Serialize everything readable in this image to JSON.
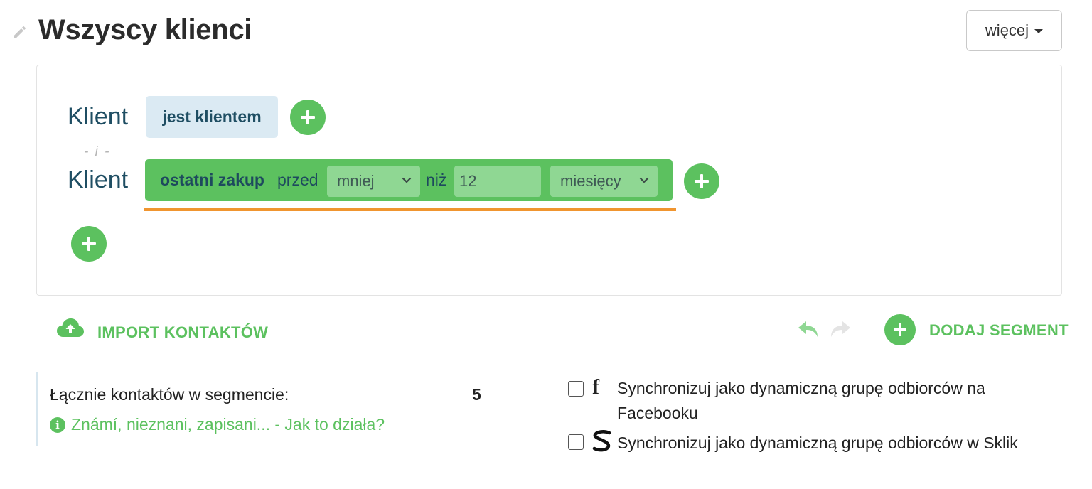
{
  "header": {
    "title": "Wszyscy klienci",
    "more_label": "więcej"
  },
  "segment": {
    "row1": {
      "label": "Klient",
      "chip": "jest klientem"
    },
    "separator": "- i -",
    "row2": {
      "label": "Klient",
      "condition_name": "ostatni zakup",
      "text_before": "przed",
      "comparison_select": "mniej",
      "text_between": "niż",
      "value_input": "12",
      "unit_select": "miesięcy"
    }
  },
  "actions": {
    "import_label": "IMPORT KONTAKTÓW",
    "add_segment_label": "DODAJ SEGMENT"
  },
  "stats": {
    "total_label": "Łącznie kontaktów w segmencie:",
    "total_value": "5",
    "help_link": "Známí, nieznani, zapisani... - Jak to działa?"
  },
  "sync": {
    "facebook_label": "Synchronizuj jako dynamiczną grupę odbiorców na Facebooku",
    "sklik_label": "Synchronizuj jako dynamiczną grupę odbiorców w Sklik"
  },
  "colors": {
    "accent_green": "#5cc15f",
    "chip_blue": "#dbeaf3",
    "underline_orange": "#f0952f",
    "label_navy": "#1f4e63"
  }
}
